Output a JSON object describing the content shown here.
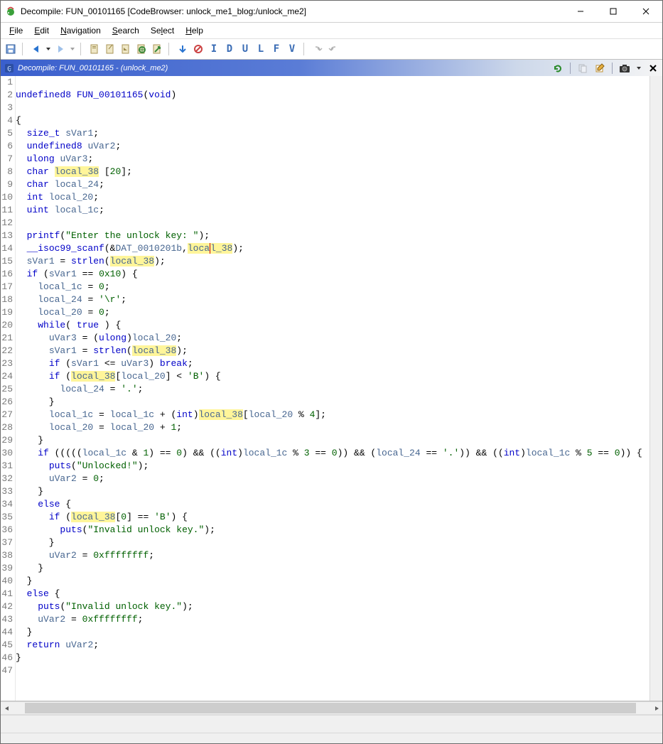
{
  "window": {
    "title": "Decompile: FUN_00101165 [CodeBrowser: unlock_me1_blog:/unlock_me2]"
  },
  "menu": {
    "file": "File",
    "edit": "Edit",
    "navigation": "Navigation",
    "search": "Search",
    "select": "Select",
    "help": "Help"
  },
  "toolbar_letters": [
    "I",
    "D",
    "U",
    "L",
    "F",
    "V"
  ],
  "panel": {
    "title": "Decompile: FUN_00101165 - (unlock_me2)"
  },
  "code": {
    "lines": [
      {
        "n": 1,
        "segs": []
      },
      {
        "n": 2,
        "segs": [
          {
            "t": "undefined8",
            "c": "kw"
          },
          {
            "t": " "
          },
          {
            "t": "FUN_00101165",
            "c": "fn"
          },
          {
            "t": "("
          },
          {
            "t": "void",
            "c": "kw"
          },
          {
            "t": ")"
          }
        ]
      },
      {
        "n": 3,
        "segs": []
      },
      {
        "n": 4,
        "segs": [
          {
            "t": "{"
          }
        ]
      },
      {
        "n": 5,
        "segs": [
          {
            "t": "  "
          },
          {
            "t": "size_t",
            "c": "kw"
          },
          {
            "t": " "
          },
          {
            "t": "sVar1",
            "c": "var"
          },
          {
            "t": ";"
          }
        ]
      },
      {
        "n": 6,
        "segs": [
          {
            "t": "  "
          },
          {
            "t": "undefined8",
            "c": "kw"
          },
          {
            "t": " "
          },
          {
            "t": "uVar2",
            "c": "var"
          },
          {
            "t": ";"
          }
        ]
      },
      {
        "n": 7,
        "segs": [
          {
            "t": "  "
          },
          {
            "t": "ulong",
            "c": "kw"
          },
          {
            "t": " "
          },
          {
            "t": "uVar3",
            "c": "var"
          },
          {
            "t": ";"
          }
        ]
      },
      {
        "n": 8,
        "segs": [
          {
            "t": "  "
          },
          {
            "t": "char",
            "c": "kw"
          },
          {
            "t": " "
          },
          {
            "t": "local_38",
            "c": "var",
            "hl": true
          },
          {
            "t": " ["
          },
          {
            "t": "20",
            "c": "lit"
          },
          {
            "t": "];"
          }
        ]
      },
      {
        "n": 9,
        "segs": [
          {
            "t": "  "
          },
          {
            "t": "char",
            "c": "kw"
          },
          {
            "t": " "
          },
          {
            "t": "local_24",
            "c": "var"
          },
          {
            "t": ";"
          }
        ]
      },
      {
        "n": 10,
        "segs": [
          {
            "t": "  "
          },
          {
            "t": "int",
            "c": "kw"
          },
          {
            "t": " "
          },
          {
            "t": "local_20",
            "c": "var"
          },
          {
            "t": ";"
          }
        ]
      },
      {
        "n": 11,
        "segs": [
          {
            "t": "  "
          },
          {
            "t": "uint",
            "c": "kw"
          },
          {
            "t": " "
          },
          {
            "t": "local_1c",
            "c": "var"
          },
          {
            "t": ";"
          }
        ]
      },
      {
        "n": 12,
        "segs": [
          {
            "t": "  "
          }
        ]
      },
      {
        "n": 13,
        "segs": [
          {
            "t": "  "
          },
          {
            "t": "printf",
            "c": "fn"
          },
          {
            "t": "("
          },
          {
            "t": "\"Enter the unlock key: \"",
            "c": "lit"
          },
          {
            "t": ");"
          }
        ]
      },
      {
        "n": 14,
        "segs": [
          {
            "t": "  "
          },
          {
            "t": "__isoc99_scanf",
            "c": "fn"
          },
          {
            "t": "(&"
          },
          {
            "t": "DAT_0010201b",
            "c": "gl"
          },
          {
            "t": ","
          },
          {
            "t": "loc",
            "c": "var",
            "hl": true
          },
          {
            "t": "a",
            "c": "var",
            "hl": true,
            "caret": true
          },
          {
            "t": "l_38",
            "c": "var",
            "hl": true
          },
          {
            "t": ");"
          }
        ]
      },
      {
        "n": 15,
        "segs": [
          {
            "t": "  "
          },
          {
            "t": "sVar1",
            "c": "var"
          },
          {
            "t": " = "
          },
          {
            "t": "strlen",
            "c": "fn"
          },
          {
            "t": "("
          },
          {
            "t": "local_38",
            "c": "var",
            "hl": true
          },
          {
            "t": ");"
          }
        ]
      },
      {
        "n": 16,
        "segs": [
          {
            "t": "  "
          },
          {
            "t": "if",
            "c": "kw"
          },
          {
            "t": " ("
          },
          {
            "t": "sVar1",
            "c": "var"
          },
          {
            "t": " == "
          },
          {
            "t": "0x10",
            "c": "lit"
          },
          {
            "t": ") {"
          }
        ]
      },
      {
        "n": 17,
        "segs": [
          {
            "t": "    "
          },
          {
            "t": "local_1c",
            "c": "var"
          },
          {
            "t": " = "
          },
          {
            "t": "0",
            "c": "lit"
          },
          {
            "t": ";"
          }
        ]
      },
      {
        "n": 18,
        "segs": [
          {
            "t": "    "
          },
          {
            "t": "local_24",
            "c": "var"
          },
          {
            "t": " = "
          },
          {
            "t": "'\\r'",
            "c": "lit"
          },
          {
            "t": ";"
          }
        ]
      },
      {
        "n": 19,
        "segs": [
          {
            "t": "    "
          },
          {
            "t": "local_20",
            "c": "var"
          },
          {
            "t": " = "
          },
          {
            "t": "0",
            "c": "lit"
          },
          {
            "t": ";"
          }
        ]
      },
      {
        "n": 20,
        "segs": [
          {
            "t": "    "
          },
          {
            "t": "while",
            "c": "kw"
          },
          {
            "t": "( "
          },
          {
            "t": "true",
            "c": "kw"
          },
          {
            "t": " ) {"
          }
        ]
      },
      {
        "n": 21,
        "segs": [
          {
            "t": "      "
          },
          {
            "t": "uVar3",
            "c": "var"
          },
          {
            "t": " = ("
          },
          {
            "t": "ulong",
            "c": "kw"
          },
          {
            "t": ")"
          },
          {
            "t": "local_20",
            "c": "var"
          },
          {
            "t": ";"
          }
        ]
      },
      {
        "n": 22,
        "segs": [
          {
            "t": "      "
          },
          {
            "t": "sVar1",
            "c": "var"
          },
          {
            "t": " = "
          },
          {
            "t": "strlen",
            "c": "fn"
          },
          {
            "t": "("
          },
          {
            "t": "local_38",
            "c": "var",
            "hl": true
          },
          {
            "t": ");"
          }
        ]
      },
      {
        "n": 23,
        "segs": [
          {
            "t": "      "
          },
          {
            "t": "if",
            "c": "kw"
          },
          {
            "t": " ("
          },
          {
            "t": "sVar1",
            "c": "var"
          },
          {
            "t": " <= "
          },
          {
            "t": "uVar3",
            "c": "var"
          },
          {
            "t": ") "
          },
          {
            "t": "break",
            "c": "kw"
          },
          {
            "t": ";"
          }
        ]
      },
      {
        "n": 24,
        "segs": [
          {
            "t": "      "
          },
          {
            "t": "if",
            "c": "kw"
          },
          {
            "t": " ("
          },
          {
            "t": "local_38",
            "c": "var",
            "hl": true
          },
          {
            "t": "["
          },
          {
            "t": "local_20",
            "c": "var"
          },
          {
            "t": "] < "
          },
          {
            "t": "'B'",
            "c": "lit"
          },
          {
            "t": ") {"
          }
        ]
      },
      {
        "n": 25,
        "segs": [
          {
            "t": "        "
          },
          {
            "t": "local_24",
            "c": "var"
          },
          {
            "t": " = "
          },
          {
            "t": "'.'",
            "c": "lit"
          },
          {
            "t": ";"
          }
        ]
      },
      {
        "n": 26,
        "segs": [
          {
            "t": "      }"
          }
        ]
      },
      {
        "n": 27,
        "segs": [
          {
            "t": "      "
          },
          {
            "t": "local_1c",
            "c": "var"
          },
          {
            "t": " = "
          },
          {
            "t": "local_1c",
            "c": "var"
          },
          {
            "t": " + ("
          },
          {
            "t": "int",
            "c": "kw"
          },
          {
            "t": ")"
          },
          {
            "t": "local_38",
            "c": "var",
            "hl": true
          },
          {
            "t": "["
          },
          {
            "t": "local_20",
            "c": "var"
          },
          {
            "t": " % "
          },
          {
            "t": "4",
            "c": "lit"
          },
          {
            "t": "];"
          }
        ]
      },
      {
        "n": 28,
        "segs": [
          {
            "t": "      "
          },
          {
            "t": "local_20",
            "c": "var"
          },
          {
            "t": " = "
          },
          {
            "t": "local_20",
            "c": "var"
          },
          {
            "t": " + "
          },
          {
            "t": "1",
            "c": "lit"
          },
          {
            "t": ";"
          }
        ]
      },
      {
        "n": 29,
        "segs": [
          {
            "t": "    }"
          }
        ]
      },
      {
        "n": 30,
        "segs": [
          {
            "t": "    "
          },
          {
            "t": "if",
            "c": "kw"
          },
          {
            "t": " ((((("
          },
          {
            "t": "local_1c",
            "c": "var"
          },
          {
            "t": " & "
          },
          {
            "t": "1",
            "c": "lit"
          },
          {
            "t": ") == "
          },
          {
            "t": "0",
            "c": "lit"
          },
          {
            "t": ") && (("
          },
          {
            "t": "int",
            "c": "kw"
          },
          {
            "t": ")"
          },
          {
            "t": "local_1c",
            "c": "var"
          },
          {
            "t": " % "
          },
          {
            "t": "3",
            "c": "lit"
          },
          {
            "t": " == "
          },
          {
            "t": "0",
            "c": "lit"
          },
          {
            "t": ")) && ("
          },
          {
            "t": "local_24",
            "c": "var"
          },
          {
            "t": " == "
          },
          {
            "t": "'.'",
            "c": "lit"
          },
          {
            "t": ")) && (("
          },
          {
            "t": "int",
            "c": "kw"
          },
          {
            "t": ")"
          },
          {
            "t": "local_1c",
            "c": "var"
          },
          {
            "t": " % "
          },
          {
            "t": "5",
            "c": "lit"
          },
          {
            "t": " == "
          },
          {
            "t": "0",
            "c": "lit"
          },
          {
            "t": ")) {"
          }
        ]
      },
      {
        "n": 31,
        "segs": [
          {
            "t": "      "
          },
          {
            "t": "puts",
            "c": "fn"
          },
          {
            "t": "("
          },
          {
            "t": "\"Unlocked!\"",
            "c": "lit"
          },
          {
            "t": ");"
          }
        ]
      },
      {
        "n": 32,
        "segs": [
          {
            "t": "      "
          },
          {
            "t": "uVar2",
            "c": "var"
          },
          {
            "t": " = "
          },
          {
            "t": "0",
            "c": "lit"
          },
          {
            "t": ";"
          }
        ]
      },
      {
        "n": 33,
        "segs": [
          {
            "t": "    }"
          }
        ]
      },
      {
        "n": 34,
        "segs": [
          {
            "t": "    "
          },
          {
            "t": "else",
            "c": "kw"
          },
          {
            "t": " {"
          }
        ]
      },
      {
        "n": 35,
        "segs": [
          {
            "t": "      "
          },
          {
            "t": "if",
            "c": "kw"
          },
          {
            "t": " ("
          },
          {
            "t": "local_38",
            "c": "var",
            "hl": true
          },
          {
            "t": "["
          },
          {
            "t": "0",
            "c": "lit"
          },
          {
            "t": "] == "
          },
          {
            "t": "'B'",
            "c": "lit"
          },
          {
            "t": ") {"
          }
        ]
      },
      {
        "n": 36,
        "segs": [
          {
            "t": "        "
          },
          {
            "t": "puts",
            "c": "fn"
          },
          {
            "t": "("
          },
          {
            "t": "\"Invalid unlock key.\"",
            "c": "lit"
          },
          {
            "t": ");"
          }
        ]
      },
      {
        "n": 37,
        "segs": [
          {
            "t": "      }"
          }
        ]
      },
      {
        "n": 38,
        "segs": [
          {
            "t": "      "
          },
          {
            "t": "uVar2",
            "c": "var"
          },
          {
            "t": " = "
          },
          {
            "t": "0xffffffff",
            "c": "lit"
          },
          {
            "t": ";"
          }
        ]
      },
      {
        "n": 39,
        "segs": [
          {
            "t": "    }"
          }
        ]
      },
      {
        "n": 40,
        "segs": [
          {
            "t": "  }"
          }
        ]
      },
      {
        "n": 41,
        "segs": [
          {
            "t": "  "
          },
          {
            "t": "else",
            "c": "kw"
          },
          {
            "t": " {"
          }
        ]
      },
      {
        "n": 42,
        "segs": [
          {
            "t": "    "
          },
          {
            "t": "puts",
            "c": "fn"
          },
          {
            "t": "("
          },
          {
            "t": "\"Invalid unlock key.\"",
            "c": "lit"
          },
          {
            "t": ");"
          }
        ]
      },
      {
        "n": 43,
        "segs": [
          {
            "t": "    "
          },
          {
            "t": "uVar2",
            "c": "var"
          },
          {
            "t": " = "
          },
          {
            "t": "0xffffffff",
            "c": "lit"
          },
          {
            "t": ";"
          }
        ]
      },
      {
        "n": 44,
        "segs": [
          {
            "t": "  }"
          }
        ]
      },
      {
        "n": 45,
        "segs": [
          {
            "t": "  "
          },
          {
            "t": "return",
            "c": "kw"
          },
          {
            "t": " "
          },
          {
            "t": "uVar2",
            "c": "var"
          },
          {
            "t": ";"
          }
        ]
      },
      {
        "n": 46,
        "segs": [
          {
            "t": "}"
          }
        ]
      },
      {
        "n": 47,
        "segs": []
      }
    ]
  }
}
